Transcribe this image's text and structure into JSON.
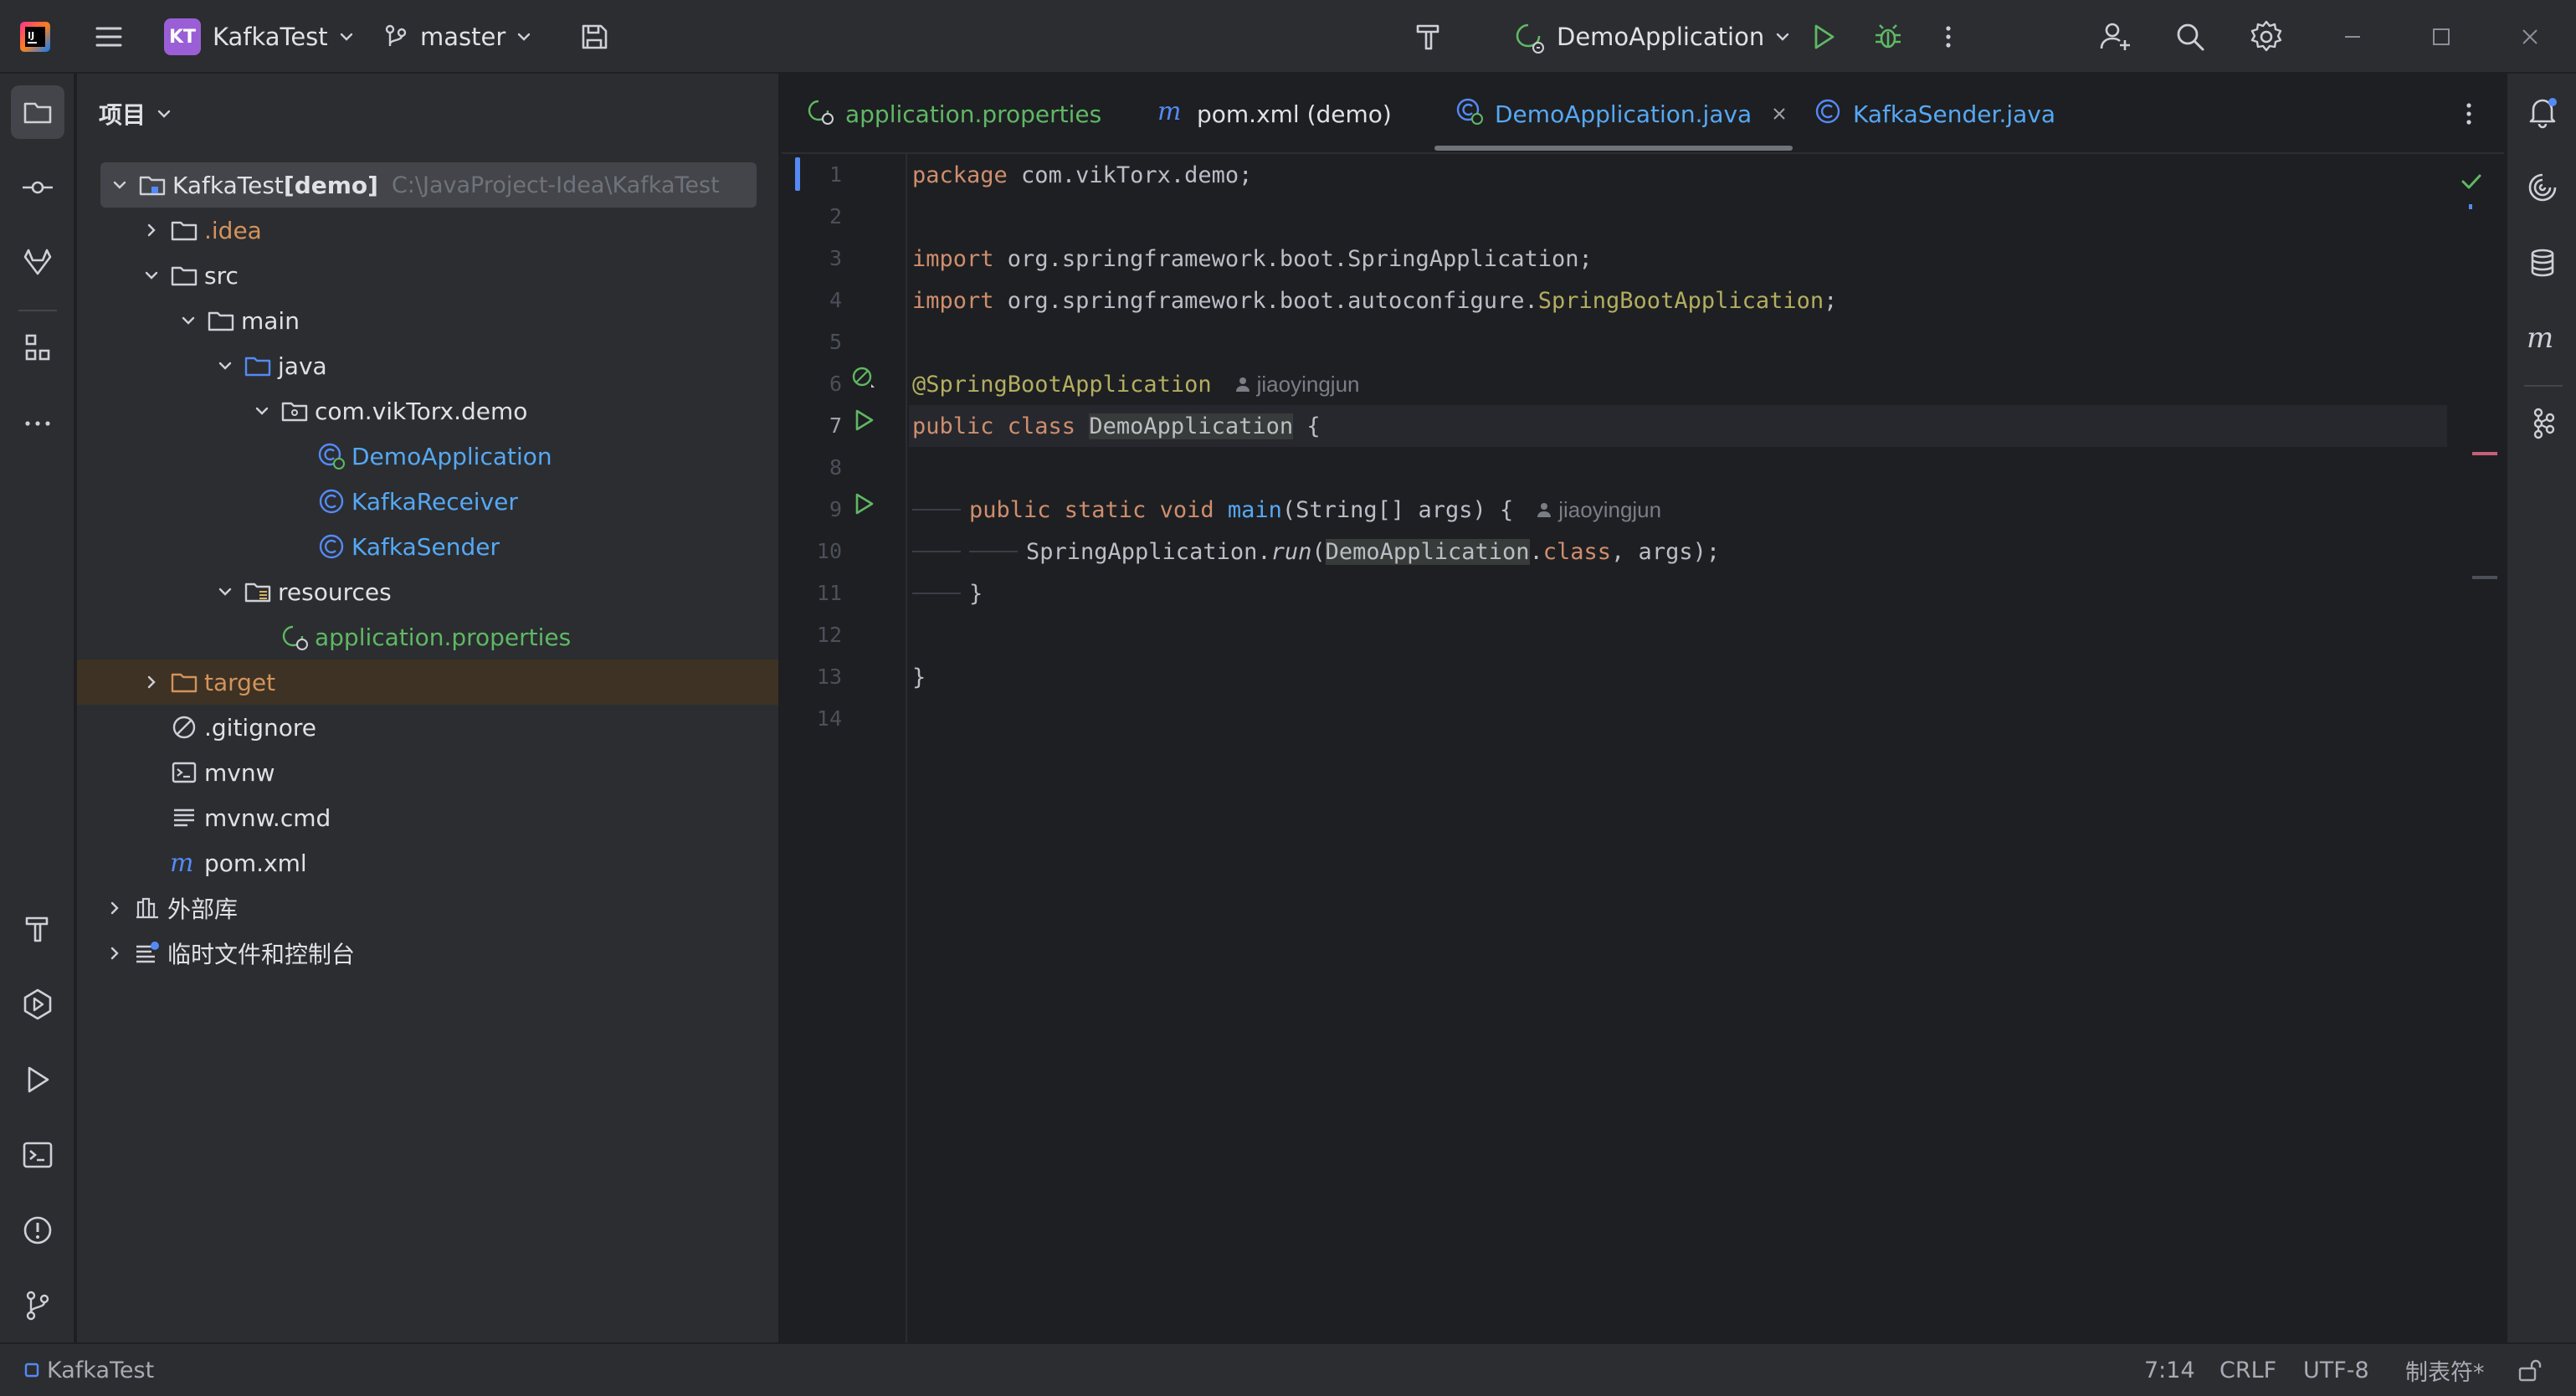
{
  "titlebar": {
    "project_badge": "KT",
    "project_name": "KafkaTest",
    "branch": "master",
    "run_config": "DemoApplication"
  },
  "project_panel": {
    "title": "项目",
    "tree": [
      {
        "label": "KafkaTest",
        "suffix": " [demo]",
        "path": "C:\\JavaProject-Idea\\KafkaTest",
        "icon": "project-folder-icon"
      },
      {
        "label": ".idea",
        "icon": "folder-icon"
      },
      {
        "label": "src",
        "icon": "folder-icon"
      },
      {
        "label": "main",
        "icon": "folder-icon"
      },
      {
        "label": "java",
        "icon": "source-folder-icon"
      },
      {
        "label": "com.vikTorx.demo",
        "icon": "package-icon"
      },
      {
        "label": "DemoApplication",
        "icon": "spring-class-icon"
      },
      {
        "label": "KafkaReceiver",
        "icon": "class-icon"
      },
      {
        "label": "KafkaSender",
        "icon": "class-icon"
      },
      {
        "label": "resources",
        "icon": "resources-folder-icon"
      },
      {
        "label": "application.properties",
        "icon": "spring-properties-icon"
      },
      {
        "label": "target",
        "icon": "excluded-folder-icon"
      },
      {
        "label": ".gitignore",
        "icon": "ignore-file-icon"
      },
      {
        "label": "mvnw",
        "icon": "shell-file-icon"
      },
      {
        "label": "mvnw.cmd",
        "icon": "text-file-icon"
      },
      {
        "label": "pom.xml",
        "icon": "maven-icon"
      },
      {
        "label": "外部库",
        "icon": "library-icon"
      },
      {
        "label": "临时文件和控制台",
        "icon": "scratches-icon"
      }
    ]
  },
  "editor": {
    "tabs": [
      {
        "label": "application.properties",
        "icon": "spring-properties-icon"
      },
      {
        "label": "pom.xml (demo)",
        "icon": "maven-icon"
      },
      {
        "label": "DemoApplication.java",
        "icon": "spring-class-icon",
        "active": true
      },
      {
        "label": "KafkaSender.java",
        "icon": "class-icon"
      }
    ],
    "line_numbers": [
      "1",
      "2",
      "3",
      "4",
      "5",
      "6",
      "7",
      "8",
      "9",
      "10",
      "11",
      "12",
      "13",
      "14"
    ],
    "code": {
      "l1_kw": "package",
      "l1_rest": " com.vikTorx.demo;",
      "l3_kw": "import",
      "l3_rest": " org.springframework.boot.SpringApplication;",
      "l4_kw": "import",
      "l4_rest": " org.springframework.boot.autoconfigure.",
      "l4_ann": "SpringBootApplication",
      "l4_end": ";",
      "l6_ann": "@SpringBootApplication",
      "author": "jiaoyingjun",
      "l7_kw": "public class ",
      "l7_class": "DemoApplication",
      "l7_end": " {",
      "l9_kw": "public static void ",
      "l9_fn": "main",
      "l9_rest": "(String[] args) {",
      "l10_a": "SpringApplication.",
      "l10_run": "run",
      "l10_b": "(",
      "l10_cls": "DemoApplication",
      "l10_c": ".",
      "l10_kw": "class",
      "l10_d": ", args);",
      "l11": "}",
      "l13": "}"
    }
  },
  "statusbar": {
    "project": "KafkaTest",
    "position": "7:14",
    "line_sep": "CRLF",
    "encoding": "UTF-8",
    "indent": "制表符*"
  }
}
